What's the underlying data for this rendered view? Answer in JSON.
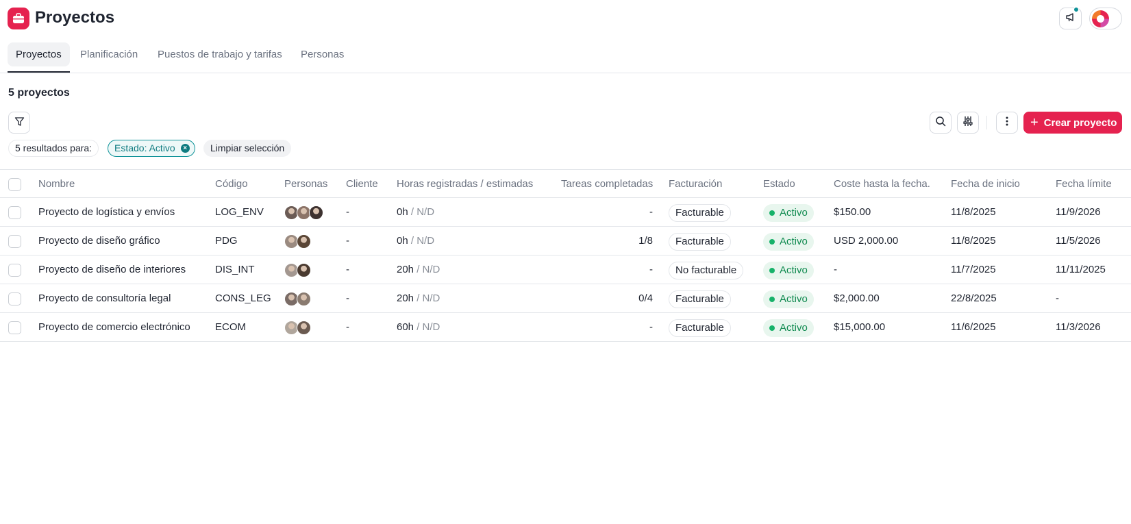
{
  "app": {
    "title": "Proyectos",
    "brand_color": "#e5224f"
  },
  "tabs": [
    {
      "label": "Proyectos",
      "active": true
    },
    {
      "label": "Planificación",
      "active": false
    },
    {
      "label": "Puestos de trabajo y tarifas",
      "active": false
    },
    {
      "label": "Personas",
      "active": false
    }
  ],
  "summary": {
    "count_label": "5 proyectos"
  },
  "toolbar": {
    "create_label": "Crear proyecto"
  },
  "filters": {
    "results_label": "5 resultados para:",
    "active_filter": "Estado: Activo",
    "clear_label": "Limpiar selección"
  },
  "table": {
    "columns": [
      "Nombre",
      "Código",
      "Personas",
      "Cliente",
      "Horas registradas / estimadas",
      "Tareas completadas",
      "Facturación",
      "Estado",
      "Coste hasta la fecha.",
      "Fecha de inicio",
      "Fecha límite"
    ],
    "rows": [
      {
        "name": "Proyecto de logística y envíos",
        "code": "LOG_ENV",
        "people": 3,
        "client": "-",
        "hours": "0h",
        "estimate": "/ N/D",
        "tasks": "-",
        "billing": "Facturable",
        "status": "Activo",
        "cost": "$150.00",
        "start": "11/8/2025",
        "due": "11/9/2026"
      },
      {
        "name": "Proyecto de diseño gráfico",
        "code": "PDG",
        "people": 2,
        "client": "-",
        "hours": "0h",
        "estimate": "/ N/D",
        "tasks": "1/8",
        "billing": "Facturable",
        "status": "Activo",
        "cost": "USD 2,000.00",
        "start": "11/8/2025",
        "due": "11/5/2026"
      },
      {
        "name": "Proyecto de diseño de interiores",
        "code": "DIS_INT",
        "people": 2,
        "client": "-",
        "hours": "20h",
        "estimate": "/ N/D",
        "tasks": "-",
        "billing": "No facturable",
        "status": "Activo",
        "cost": "-",
        "start": "11/7/2025",
        "due": "11/11/2025"
      },
      {
        "name": "Proyecto de consultoría legal",
        "code": "CONS_LEG",
        "people": 2,
        "client": "-",
        "hours": "20h",
        "estimate": "/ N/D",
        "tasks": "0/4",
        "billing": "Facturable",
        "status": "Activo",
        "cost": "$2,000.00",
        "start": "22/8/2025",
        "due": "-"
      },
      {
        "name": "Proyecto de comercio electrónico",
        "code": "ECOM",
        "people": 2,
        "client": "-",
        "hours": "60h",
        "estimate": "/ N/D",
        "tasks": "-",
        "billing": "Facturable",
        "status": "Activo",
        "cost": "$15,000.00",
        "start": "11/6/2025",
        "due": "11/3/2026"
      }
    ]
  }
}
